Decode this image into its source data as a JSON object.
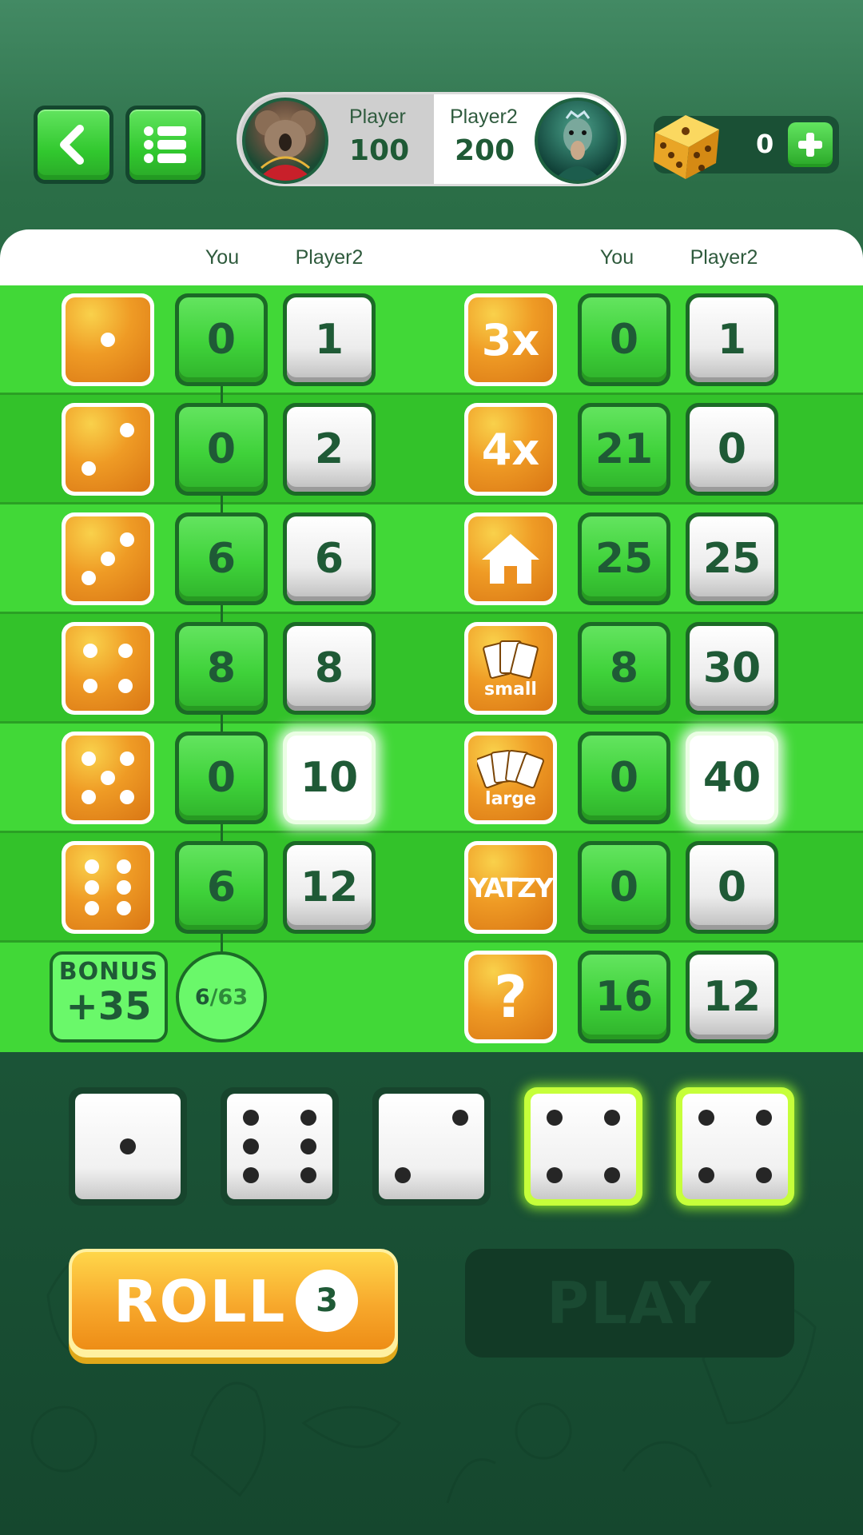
{
  "header": {
    "back_icon": "chevron-left-icon",
    "menu_icon": "list-icon",
    "player1": {
      "name": "Player",
      "score": "100",
      "avatar": "koala-avatar"
    },
    "player2": {
      "name": "Player2",
      "score": "200",
      "avatar": "emu-avatar"
    },
    "coins": {
      "count": "0",
      "icon": "gold-die-icon",
      "add_icon": "plus-icon"
    }
  },
  "board": {
    "columns": {
      "you": "You",
      "player2": "Player2"
    },
    "upper": [
      {
        "icon": "die-face-1",
        "you": "0",
        "p2": "1"
      },
      {
        "icon": "die-face-2",
        "you": "0",
        "p2": "2"
      },
      {
        "icon": "die-face-3",
        "you": "6",
        "p2": "6"
      },
      {
        "icon": "die-face-4",
        "you": "8",
        "p2": "8"
      },
      {
        "icon": "die-face-5",
        "you": "0",
        "p2": "10"
      },
      {
        "icon": "die-face-6",
        "you": "6",
        "p2": "12"
      }
    ],
    "lower": [
      {
        "label": "3x",
        "you": "0",
        "p2": "1"
      },
      {
        "label": "4x",
        "you": "21",
        "p2": "0"
      },
      {
        "icon": "house-icon",
        "you": "25",
        "p2": "25"
      },
      {
        "icon": "cards-icon",
        "label": "small",
        "you": "8",
        "p2": "30"
      },
      {
        "icon": "cards-icon",
        "label": "large",
        "you": "0",
        "p2": "40"
      },
      {
        "label": "YATZY",
        "you": "0",
        "p2": "0"
      },
      {
        "label": "?",
        "you": "16",
        "p2": "12"
      }
    ],
    "bonus": {
      "title": "BONUS",
      "value": "+35"
    },
    "progress": {
      "current": "6",
      "target": "/63"
    }
  },
  "dice": [
    {
      "face": 1,
      "held": false
    },
    {
      "face": 6,
      "held": false
    },
    {
      "face": 2,
      "held": false
    },
    {
      "face": 4,
      "held": true
    },
    {
      "face": 4,
      "held": true
    }
  ],
  "actions": {
    "roll_label": "ROLL",
    "rolls_left": "3",
    "play_label": "PLAY"
  },
  "colors": {
    "accent_green": "#41d837",
    "orange": "#ef9b25",
    "dark_bg": "#1e5a3b"
  }
}
